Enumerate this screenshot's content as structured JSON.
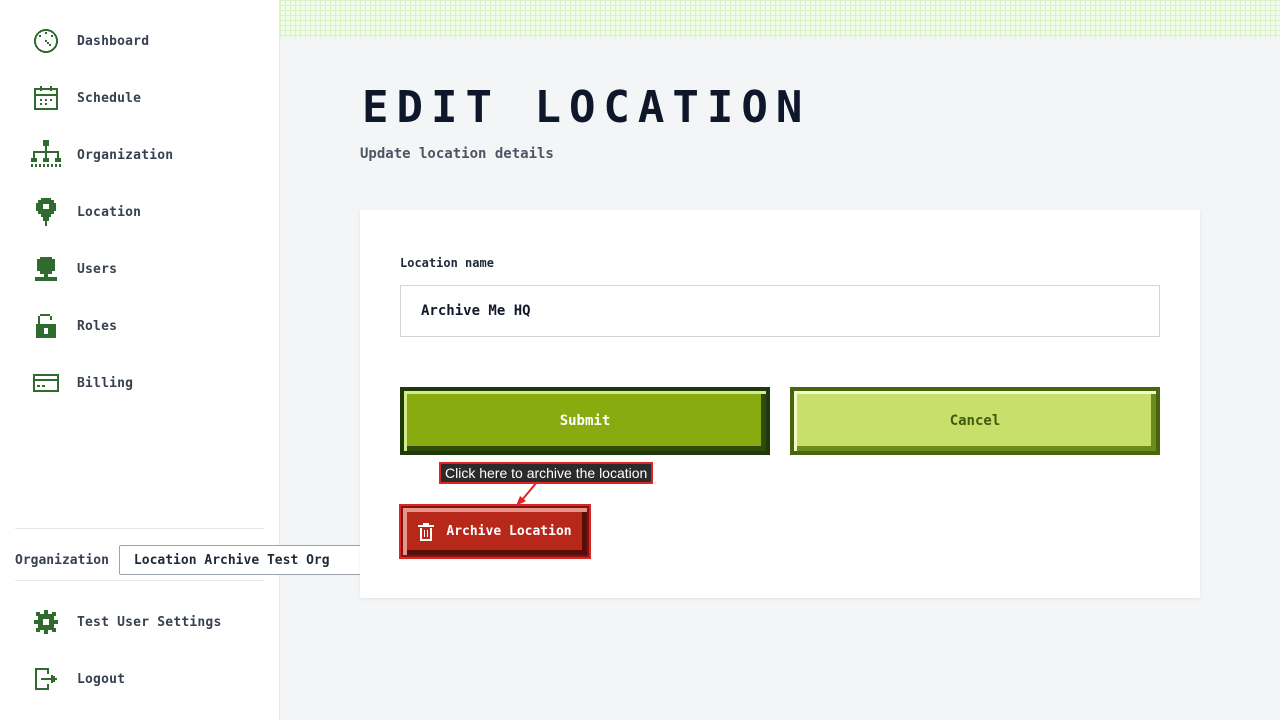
{
  "sidebar": {
    "items": [
      {
        "label": "Dashboard",
        "icon": "dashboard-icon"
      },
      {
        "label": "Schedule",
        "icon": "calendar-icon"
      },
      {
        "label": "Organization",
        "icon": "org-chart-icon"
      },
      {
        "label": "Location",
        "icon": "map-pin-icon"
      },
      {
        "label": "Users",
        "icon": "user-icon"
      },
      {
        "label": "Roles",
        "icon": "unlock-icon"
      },
      {
        "label": "Billing",
        "icon": "credit-card-icon"
      }
    ],
    "organization": {
      "label": "Organization",
      "selected": "Location Archive Test Org"
    },
    "bottom_items": [
      {
        "label": "Test User Settings",
        "icon": "gear-icon"
      },
      {
        "label": "Logout",
        "icon": "logout-icon"
      }
    ]
  },
  "main": {
    "title": "EDIT LOCATION",
    "subtitle": "Update location details",
    "form": {
      "name_label": "Location name",
      "name_value": "Archive Me HQ",
      "submit_label": "Submit",
      "cancel_label": "Cancel",
      "archive_label": "Archive Location",
      "archive_hint": "Click here to archive the location"
    }
  },
  "colors": {
    "icon_green": "#2f6a2e",
    "submit_bg": "#88ab0f",
    "cancel_bg": "#c9df6b",
    "archive_bg": "#b7281b",
    "highlight_red": "#e02424"
  }
}
